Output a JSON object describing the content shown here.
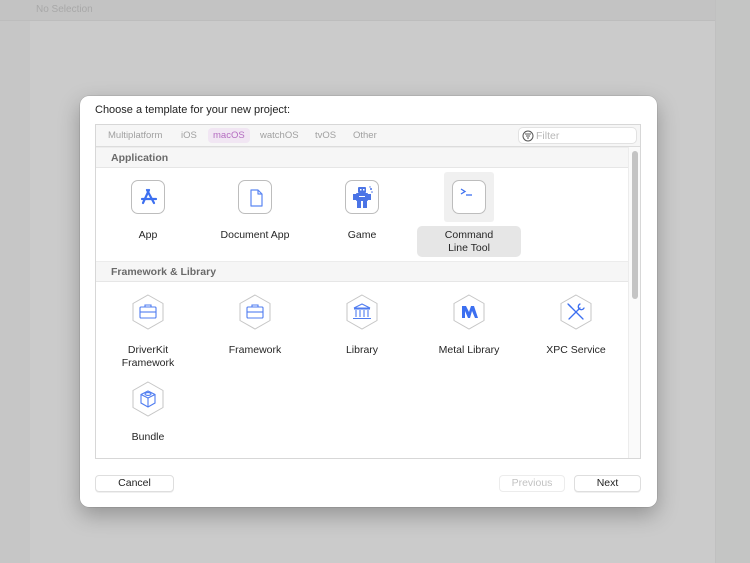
{
  "window": {
    "toolbar_status": "No Selection"
  },
  "sheet": {
    "title": "Choose a template for your new project:",
    "platform_tabs": [
      {
        "label": "Multiplatform",
        "active": false
      },
      {
        "label": "iOS",
        "active": false
      },
      {
        "label": "macOS",
        "active": true
      },
      {
        "label": "watchOS",
        "active": false
      },
      {
        "label": "tvOS",
        "active": false
      },
      {
        "label": "Other",
        "active": false
      }
    ],
    "filter": {
      "placeholder": "Filter",
      "value": "",
      "icon": "filter-icon"
    },
    "sections": [
      {
        "title": "Application",
        "templates": [
          {
            "label": "App",
            "icon": "app-store-icon",
            "selected": false
          },
          {
            "label": "Document App",
            "icon": "document-icon",
            "selected": false
          },
          {
            "label": "Game",
            "icon": "game-robot-icon",
            "selected": false
          },
          {
            "label": "Command\nLine Tool",
            "label_lines": [
              "Command",
              "Line Tool"
            ],
            "icon": "terminal-icon",
            "selected": true
          }
        ]
      },
      {
        "title": "Framework & Library",
        "templates": [
          {
            "label": "DriverKit\nFramework",
            "label_lines": [
              "DriverKit",
              "Framework"
            ],
            "icon": "toolbox-icon",
            "selected": false
          },
          {
            "label": "Framework",
            "icon": "toolbox-icon",
            "selected": false
          },
          {
            "label": "Library",
            "icon": "bank-building-icon",
            "selected": false
          },
          {
            "label": "Metal Library",
            "icon": "metal-icon",
            "selected": false
          },
          {
            "label": "XPC Service",
            "icon": "tools-icon",
            "selected": false
          },
          {
            "label": "Bundle",
            "icon": "cube-icon",
            "selected": false
          }
        ]
      }
    ],
    "buttons": {
      "cancel": "Cancel",
      "previous": "Previous",
      "next": "Next"
    },
    "colors": {
      "accent_tab_bg": "#f1e6f3",
      "accent_tab_text": "#b46cc0",
      "icon_blue": "#3c6ff0"
    }
  }
}
